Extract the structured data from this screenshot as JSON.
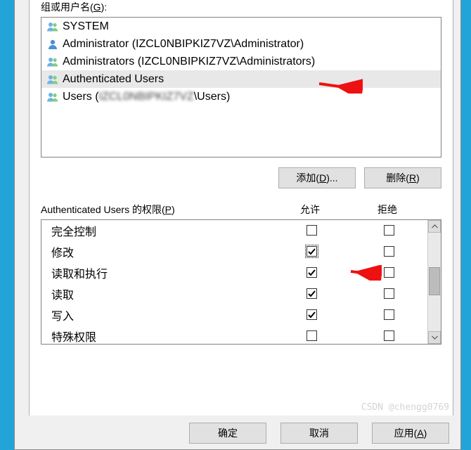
{
  "labels": {
    "groups_label_prefix": "组或用户名(",
    "groups_label_key": "G",
    "groups_label_suffix": "):",
    "add": "添加(D)...",
    "remove": "删除(R)",
    "perm_label_prefix": "Authenticated Users 的权限(",
    "perm_label_key": "P",
    "perm_label_suffix": ")",
    "allow": "允许",
    "deny": "拒绝",
    "ok": "确定",
    "cancel": "取消",
    "apply": "应用(A)"
  },
  "users": [
    {
      "name": "SYSTEM",
      "icon": "group",
      "selected": false,
      "blurred": false
    },
    {
      "name": "Administrator (IZCL0NBIPKIZ7VZ\\Administrator)",
      "icon": "user",
      "selected": false,
      "blurred": false
    },
    {
      "name": "Administrators (IZCL0NBIPKIZ7VZ\\Administrators)",
      "icon": "group",
      "selected": false,
      "blurred": false
    },
    {
      "name": "Authenticated Users",
      "icon": "group",
      "selected": true,
      "blurred": false
    },
    {
      "name": "Users (IZCL0NBIPKIZ7VZ\\Users)",
      "icon": "group",
      "selected": false,
      "blurred": true
    }
  ],
  "permissions": [
    {
      "name": "完全控制",
      "allow": false,
      "deny": false,
      "focus": false
    },
    {
      "name": "修改",
      "allow": true,
      "deny": false,
      "focus": true
    },
    {
      "name": "读取和执行",
      "allow": true,
      "deny": false,
      "focus": false
    },
    {
      "name": "读取",
      "allow": true,
      "deny": false,
      "focus": false
    },
    {
      "name": "写入",
      "allow": true,
      "deny": false,
      "focus": false
    },
    {
      "name": "特殊权限",
      "allow": false,
      "deny": false,
      "focus": false
    }
  ],
  "watermark": "CSDN @chengg0769"
}
